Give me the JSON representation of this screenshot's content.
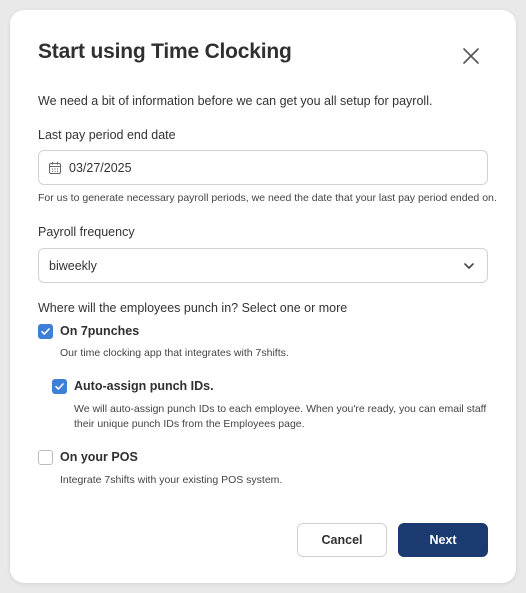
{
  "dialog": {
    "title": "Start using Time Clocking",
    "intro": "We need a bit of information before we can get you all setup for payroll."
  },
  "last_pay_period": {
    "label": "Last pay period end date",
    "value": "03/27/2025",
    "help": "For us to generate necessary payroll periods, we need the date that your last pay period ended on."
  },
  "payroll_frequency": {
    "label": "Payroll frequency",
    "value": "biweekly"
  },
  "punch_in": {
    "question": "Where will the employees punch in? Select one or more",
    "options": [
      {
        "label": "On 7punches",
        "description": "Our time clocking app that integrates with 7shifts.",
        "checked": true
      },
      {
        "label": "Auto-assign punch IDs.",
        "description_line1": "We will auto-assign punch IDs to each employee. When you're ready, you can email staff",
        "description_line2": "their unique punch IDs from the Employees page.",
        "checked": true
      },
      {
        "label": "On your POS",
        "description": "Integrate 7shifts with your existing POS system.",
        "checked": false
      }
    ]
  },
  "buttons": {
    "cancel": "Cancel",
    "next": "Next"
  },
  "colors": {
    "accent": "#3e7fd8",
    "primary_button": "#1b3a70"
  }
}
